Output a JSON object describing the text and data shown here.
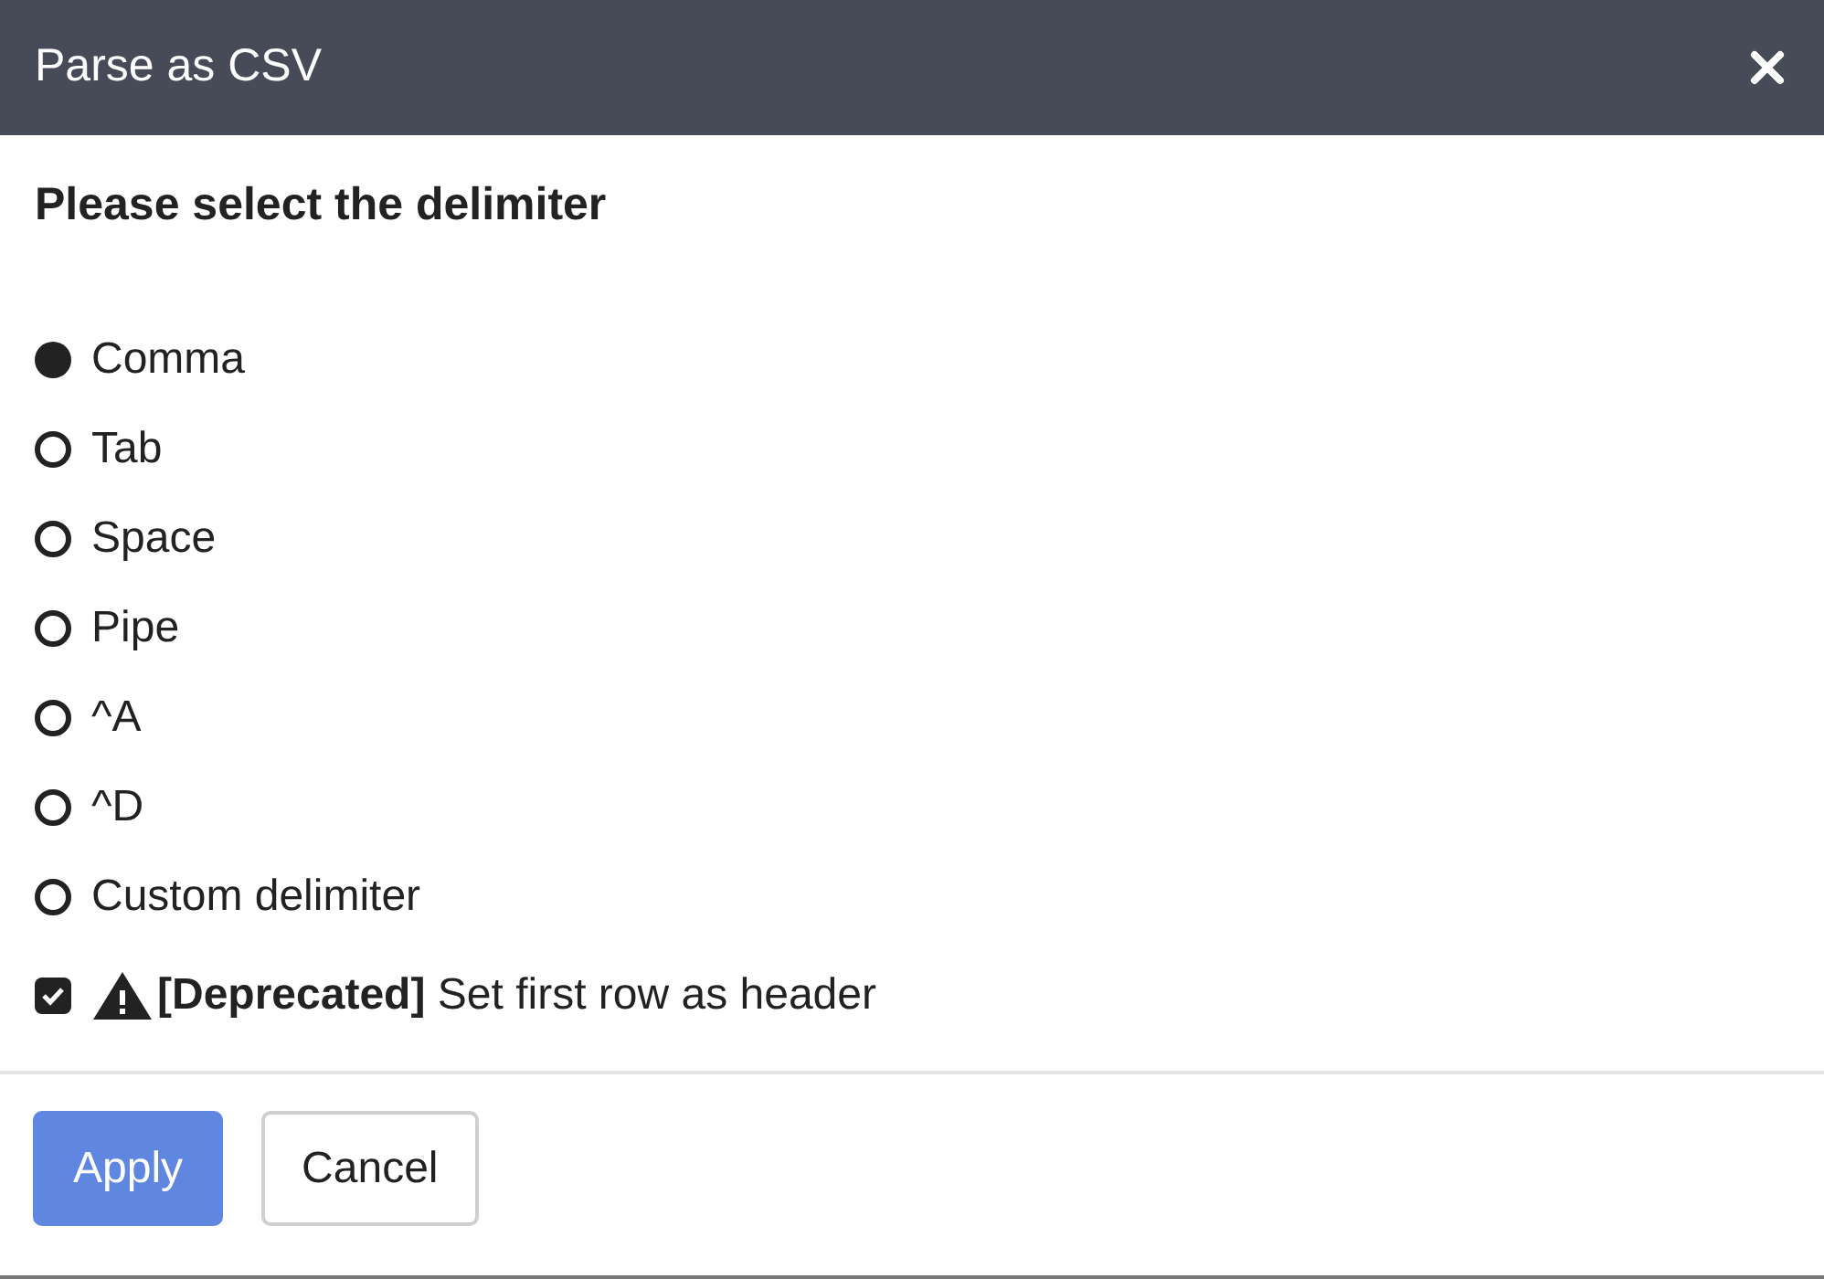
{
  "dialog": {
    "title": "Parse as CSV",
    "heading": "Please select the delimiter",
    "options": [
      {
        "label": "Comma",
        "selected": true
      },
      {
        "label": "Tab",
        "selected": false
      },
      {
        "label": "Space",
        "selected": false
      },
      {
        "label": "Pipe",
        "selected": false
      },
      {
        "label": "^A",
        "selected": false
      },
      {
        "label": "^D",
        "selected": false
      },
      {
        "label": "Custom delimiter",
        "selected": false
      }
    ],
    "header_checkbox": {
      "label": "**[Deprecated]** Set first row as header",
      "checked": true
    },
    "buttons": [
      {
        "label": "Apply",
        "kind": "primary"
      },
      {
        "label": "Cancel",
        "kind": "secondary"
      }
    ]
  }
}
